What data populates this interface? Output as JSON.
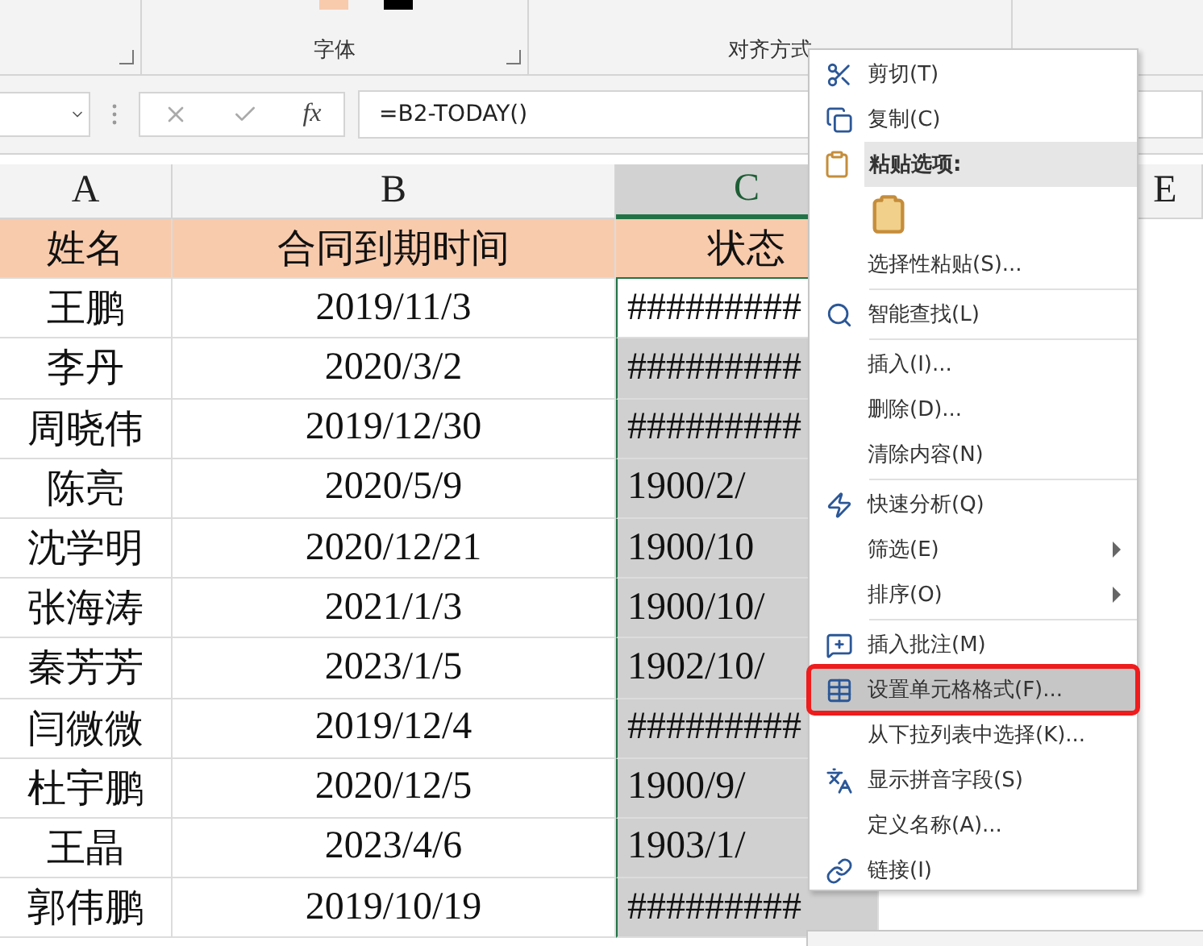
{
  "ribbon": {
    "groups": [
      {
        "label": "字体"
      },
      {
        "label": "对齐方式"
      }
    ]
  },
  "formula_bar": {
    "fx": "fx",
    "formula": "=B2-TODAY()"
  },
  "columns": [
    {
      "label": "A",
      "selected": false
    },
    {
      "label": "B",
      "selected": false
    },
    {
      "label": "C",
      "selected": true
    },
    {
      "label": "E",
      "selected": false
    }
  ],
  "header_row": [
    "姓名",
    "合同到期时间",
    "状态"
  ],
  "rows": [
    {
      "name": "王鹏",
      "date": "2019/11/3",
      "status": "#########",
      "active": true
    },
    {
      "name": "李丹",
      "date": "2020/3/2",
      "status": "#########",
      "active": false
    },
    {
      "name": "周晓伟",
      "date": "2019/12/30",
      "status": "#########",
      "active": false
    },
    {
      "name": "陈亮",
      "date": "2020/5/9",
      "status": "1900/2/",
      "active": false
    },
    {
      "name": "沈学明",
      "date": "2020/12/21",
      "status": "1900/10",
      "active": false
    },
    {
      "name": "张海涛",
      "date": "2021/1/3",
      "status": "1900/10/",
      "active": false
    },
    {
      "name": "秦芳芳",
      "date": "2023/1/5",
      "status": "1902/10/",
      "active": false
    },
    {
      "name": "闫微微",
      "date": "2019/12/4",
      "status": "#########",
      "active": false
    },
    {
      "name": "杜宇鹏",
      "date": "2020/12/5",
      "status": "1900/9/",
      "active": false
    },
    {
      "name": "王晶",
      "date": "2023/4/6",
      "status": "1903/1/",
      "active": false
    },
    {
      "name": "郭伟鹏",
      "date": "2019/10/19",
      "status": "#########",
      "active": false
    }
  ],
  "context_menu": [
    {
      "kind": "command",
      "label": "剪切(T)",
      "submenu": false,
      "highlighted": false
    },
    {
      "kind": "command",
      "label": "复制(C)",
      "submenu": false,
      "highlighted": false
    },
    {
      "kind": "header",
      "label": "粘贴选项:"
    },
    {
      "kind": "paste-option"
    },
    {
      "kind": "command",
      "label": "选择性粘贴(S)...",
      "submenu": false,
      "highlighted": false
    },
    {
      "kind": "separator"
    },
    {
      "kind": "command",
      "label": "智能查找(L)",
      "submenu": false,
      "highlighted": false
    },
    {
      "kind": "separator"
    },
    {
      "kind": "command",
      "label": "插入(I)...",
      "submenu": false,
      "highlighted": false
    },
    {
      "kind": "command",
      "label": "删除(D)...",
      "submenu": false,
      "highlighted": false
    },
    {
      "kind": "command",
      "label": "清除内容(N)",
      "submenu": false,
      "highlighted": false
    },
    {
      "kind": "separator"
    },
    {
      "kind": "command",
      "label": "快速分析(Q)",
      "submenu": false,
      "highlighted": false
    },
    {
      "kind": "command",
      "label": "筛选(E)",
      "submenu": true,
      "highlighted": false
    },
    {
      "kind": "command",
      "label": "排序(O)",
      "submenu": true,
      "highlighted": false
    },
    {
      "kind": "separator"
    },
    {
      "kind": "command",
      "label": "插入批注(M)",
      "submenu": false,
      "highlighted": false
    },
    {
      "kind": "command",
      "label": "设置单元格格式(F)...",
      "submenu": false,
      "highlighted": true
    },
    {
      "kind": "command",
      "label": "从下拉列表中选择(K)...",
      "submenu": false,
      "highlighted": false
    },
    {
      "kind": "command",
      "label": "显示拼音字段(S)",
      "submenu": false,
      "highlighted": false
    },
    {
      "kind": "command",
      "label": "定义名称(A)...",
      "submenu": false,
      "highlighted": false
    },
    {
      "kind": "command",
      "label": "链接(I)",
      "submenu": false,
      "highlighted": false
    }
  ]
}
